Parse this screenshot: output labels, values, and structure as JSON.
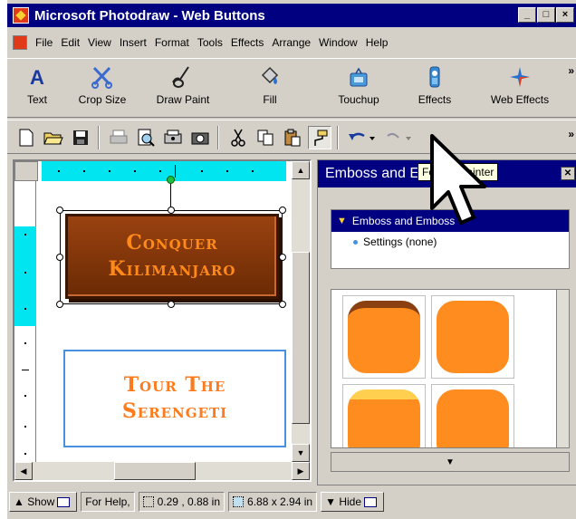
{
  "window": {
    "title": "Microsoft Photodraw - Web Buttons",
    "controls": [
      "_",
      "□",
      "×"
    ]
  },
  "menubar": [
    "File",
    "Edit",
    "View",
    "Insert",
    "Format",
    "Tools",
    "Effects",
    "Arrange",
    "Window",
    "Help"
  ],
  "big_toolbar": [
    {
      "label": "Text",
      "icon": "text-icon"
    },
    {
      "label": "Crop Size",
      "icon": "crop-icon"
    },
    {
      "label": "Draw Paint",
      "icon": "paintbrush-icon"
    },
    {
      "label": "Fill",
      "icon": "fill-bucket-icon"
    },
    {
      "label": "Touchup",
      "icon": "touchup-icon"
    },
    {
      "label": "Effects",
      "icon": "effects-icon"
    },
    {
      "label": "Web Effects",
      "icon": "web-effects-icon"
    }
  ],
  "more_glyph": "»",
  "canvas": {
    "button1_line1": "Conquer",
    "button1_line2": "Kilimanjaro",
    "button2_line1": "Tour The",
    "button2_line2": "Serengeti"
  },
  "pane": {
    "title": "Emboss and Emboss",
    "tree_header": "Emboss and Emboss",
    "tree_item": "Settings (none)",
    "footer_glyph": "▼"
  },
  "tooltip": "Format Painter",
  "status": {
    "show": "Show",
    "help": "For Help,",
    "position": "0.29 , 0.88 in",
    "size": "6.88 x 2.94 in",
    "hide": "Hide"
  },
  "colors": {
    "titlebar": "#000080",
    "button1_fill": "#7a3208",
    "button1_text": "#ff8a1a",
    "button2_text": "#ff7a1a",
    "ruler": "#00e5f0",
    "swatch": "#ff8c1f"
  }
}
